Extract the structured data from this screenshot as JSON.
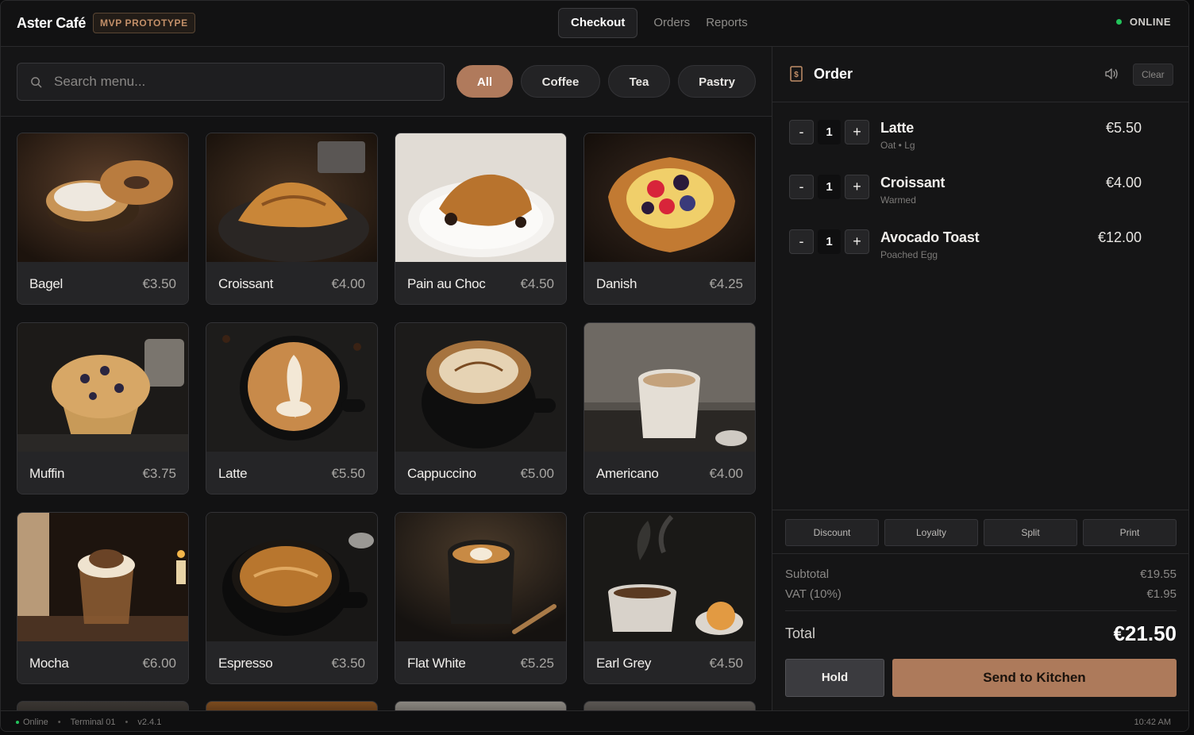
{
  "header": {
    "brand": "Aster Café",
    "badge": "MVP PROTOTYPE",
    "tabs": [
      "Checkout",
      "Orders",
      "Reports"
    ],
    "status": "ONLINE",
    "status_color": "#23c35b"
  },
  "menu": {
    "search_placeholder": "Search menu...",
    "categories": [
      "All",
      "Coffee",
      "Tea",
      "Pastry"
    ],
    "items": [
      {
        "name": "Bagel",
        "price": "€3.50"
      },
      {
        "name": "Croissant",
        "price": "€4.00"
      },
      {
        "name": "Pain au Choc",
        "price": "€4.50"
      },
      {
        "name": "Danish",
        "price": "€4.25"
      },
      {
        "name": "Muffin",
        "price": "€3.75"
      },
      {
        "name": "Latte",
        "price": "€5.50"
      },
      {
        "name": "Cappuccino",
        "price": "€5.00"
      },
      {
        "name": "Americano",
        "price": "€4.00"
      },
      {
        "name": "Mocha",
        "price": "€6.00"
      },
      {
        "name": "Espresso",
        "price": "€3.50"
      },
      {
        "name": "Flat White",
        "price": "€5.25"
      },
      {
        "name": "Earl Grey",
        "price": "€4.50"
      }
    ]
  },
  "order": {
    "title": "Order",
    "clear_label": "Clear",
    "items": [
      {
        "name": "Latte",
        "modifier": "Oat • Lg",
        "qty": "1",
        "price": "€5.50"
      },
      {
        "name": "Croissant",
        "modifier": "Warmed",
        "qty": "1",
        "price": "€4.00"
      },
      {
        "name": "Avocado Toast",
        "modifier": "Poached Egg",
        "qty": "1",
        "price": "€12.00"
      }
    ],
    "minus_label": "-",
    "plus_label": "+",
    "actions": [
      "Discount",
      "Loyalty",
      "Split",
      "Print"
    ],
    "subtotal_label": "Subtotal",
    "subtotal": "€19.55",
    "vat_label": "VAT (10%)",
    "vat": "€1.95",
    "total_label": "Total",
    "total": "€21.50",
    "hold_label": "Hold",
    "send_label": "Send to Kitchen",
    "accent_color": "#ad7a5b"
  },
  "footer": {
    "status": "Online",
    "terminal": "Terminal 01",
    "version": "v2.4.1",
    "time": "10:42 AM"
  }
}
